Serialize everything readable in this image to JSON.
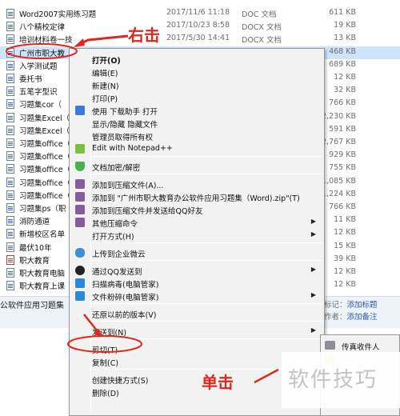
{
  "files": [
    {
      "name": "Word2007实用练习题",
      "date": "2017/11/6 11:18",
      "type": "DOC 文档",
      "size": "611 KB",
      "icon": "doc-icon",
      "selected": false
    },
    {
      "name": "八个精校定律",
      "date": "2017/10/23 8:58",
      "type": "DOCX 文档",
      "size": "19 KB",
      "icon": "doc-icon",
      "selected": false
    },
    {
      "name": "培训材料卷一技",
      "date": "2017/5/30 14:41",
      "type": "DOCX 文档",
      "size": "13 KB",
      "icon": "doc-icon",
      "selected": false
    },
    {
      "name": "广州市职大教",
      "date": "",
      "type": "",
      "size": "468 KB",
      "icon": "doc-icon",
      "selected": true
    },
    {
      "name": "入学测试题",
      "date": "",
      "type": "",
      "size": "689 KB",
      "icon": "doc-icon",
      "selected": false
    },
    {
      "name": "委托书",
      "date": "",
      "type": "",
      "size": "12 KB",
      "icon": "doc-icon",
      "selected": false
    },
    {
      "name": "五笔字型识",
      "date": "",
      "type": "",
      "size": "32 KB",
      "icon": "doc-icon",
      "selected": false
    },
    {
      "name": "习题集cor（",
      "date": "",
      "type": "",
      "size": "766 KB",
      "icon": "doc-icon",
      "selected": false
    },
    {
      "name": "习题集Excel（",
      "date": "",
      "type": "",
      "size": "2,230 KB",
      "icon": "doc-icon",
      "selected": false
    },
    {
      "name": "习题集Excel（",
      "date": "",
      "type": "",
      "size": "591 KB",
      "icon": "doc-icon",
      "selected": false
    },
    {
      "name": "习题集office（",
      "date": "",
      "type": "",
      "size": "2,767 KB",
      "icon": "doc-icon",
      "selected": false
    },
    {
      "name": "习题集office（",
      "date": "",
      "type": "",
      "size": "929 KB",
      "icon": "doc-icon",
      "selected": false
    },
    {
      "name": "习题集office（",
      "date": "",
      "type": "",
      "size": "755 KB",
      "icon": "doc-icon",
      "selected": false
    },
    {
      "name": "习题集office（",
      "date": "",
      "type": "",
      "size": "1,085 KB",
      "icon": "doc-icon",
      "selected": false
    },
    {
      "name": "习题集office（",
      "date": "",
      "type": "",
      "size": "1,224 KB",
      "icon": "doc-icon",
      "selected": false
    },
    {
      "name": "习题集ps（职",
      "date": "",
      "type": "",
      "size": "766 KB",
      "icon": "doc-icon",
      "selected": false
    },
    {
      "name": "消防通道",
      "date": "",
      "type": "",
      "size": "11 KB",
      "icon": "doc-icon",
      "selected": false
    },
    {
      "name": "新增校区名单",
      "date": "",
      "type": "",
      "size": "12 KB",
      "icon": "doc-icon",
      "selected": false
    },
    {
      "name": "最伏10年",
      "date": "",
      "type": "",
      "size": "15 KB",
      "icon": "doc-icon",
      "selected": false
    },
    {
      "name": "职大教育",
      "date": "",
      "type": "",
      "size": "39 KB",
      "icon": "doc-red-icon",
      "selected": false
    },
    {
      "name": "职大教育电脑",
      "date": "",
      "type": "",
      "size": "12 KB",
      "icon": "doc-icon",
      "selected": false
    },
    {
      "name": "职大教育上课",
      "date": "",
      "type": "",
      "size": "12 KB",
      "icon": "doc-icon",
      "selected": false
    }
  ],
  "details": {
    "title": "公软件应用习题集",
    "fields": [
      {
        "label": "标记：",
        "value": "添加标题"
      },
      {
        "label": "作者：",
        "value": "添加备注"
      }
    ]
  },
  "context_menu": {
    "items": [
      {
        "kind": "item",
        "label": "打开(O)",
        "bold": true,
        "icon": "",
        "submenu": false
      },
      {
        "kind": "item",
        "label": "编辑(E)",
        "icon": "",
        "submenu": false
      },
      {
        "kind": "item",
        "label": "新建(N)",
        "icon": "",
        "submenu": false
      },
      {
        "kind": "item",
        "label": "打印(P)",
        "icon": "",
        "submenu": false
      },
      {
        "kind": "item",
        "label": "使用 下载助手 打开",
        "icon": "download-icon",
        "submenu": false
      },
      {
        "kind": "item",
        "label": "显示/隐藏 隐藏文件",
        "icon": "",
        "submenu": false
      },
      {
        "kind": "item",
        "label": "管理员取得所有权",
        "icon": "",
        "submenu": false
      },
      {
        "kind": "item",
        "label": "Edit with Notepad++",
        "icon": "notepad-icon",
        "submenu": false
      },
      {
        "kind": "sep"
      },
      {
        "kind": "item",
        "label": "文档加密/解密",
        "icon": "shield-icon",
        "submenu": false
      },
      {
        "kind": "sep"
      },
      {
        "kind": "item",
        "label": "添加到压缩文件(A)...",
        "icon": "archive-icon",
        "submenu": false
      },
      {
        "kind": "item",
        "label": "添加到 \"广州市职大教育办公软件应用习题集（Word).zip\"(T)",
        "icon": "archive-icon",
        "submenu": false
      },
      {
        "kind": "item",
        "label": "添加到压缩文件并发送给QQ好友",
        "icon": "archive-icon",
        "submenu": false
      },
      {
        "kind": "item",
        "label": "其他压缩命令",
        "icon": "archive-icon",
        "submenu": true
      },
      {
        "kind": "item",
        "label": "打开方式(H)",
        "icon": "",
        "submenu": true
      },
      {
        "kind": "sep"
      },
      {
        "kind": "item",
        "label": "上传到企业微云",
        "icon": "cloud-icon",
        "submenu": false
      },
      {
        "kind": "sep"
      },
      {
        "kind": "item",
        "label": "通过QQ发送到",
        "icon": "qq-icon",
        "submenu": true
      },
      {
        "kind": "item",
        "label": "扫描病毒(电脑管家)",
        "icon": "guard-icon",
        "submenu": false
      },
      {
        "kind": "item",
        "label": "文件粉碎(电脑管家)",
        "icon": "guard-icon",
        "submenu": true
      },
      {
        "kind": "sep"
      },
      {
        "kind": "item",
        "label": "还原以前的版本(V)",
        "icon": "",
        "submenu": false
      },
      {
        "kind": "sep"
      },
      {
        "kind": "item",
        "label": "发送到(N)",
        "icon": "",
        "submenu": true,
        "highlighted": true
      },
      {
        "kind": "sep"
      },
      {
        "kind": "item",
        "label": "剪切(T)",
        "icon": "",
        "submenu": false
      },
      {
        "kind": "item",
        "label": "复制(C)",
        "icon": "",
        "submenu": false
      },
      {
        "kind": "sep"
      },
      {
        "kind": "item",
        "label": "创建快捷方式(S)",
        "icon": "",
        "submenu": false
      },
      {
        "kind": "item",
        "label": "删除(D)",
        "icon": "",
        "submenu": false
      }
    ]
  },
  "submenu": {
    "items": [
      {
        "label": "传真收件人",
        "icon": "fax-icon"
      },
      {
        "label": "",
        "icon": "folder-icon"
      }
    ]
  },
  "annotations": {
    "right_click": "右击",
    "single_click": "单击",
    "watermark": "软件技巧"
  },
  "colors": {
    "annotation_red": "#e0271c",
    "selection": "#cfe3fa",
    "menu_bg": "#f2f2f2"
  }
}
